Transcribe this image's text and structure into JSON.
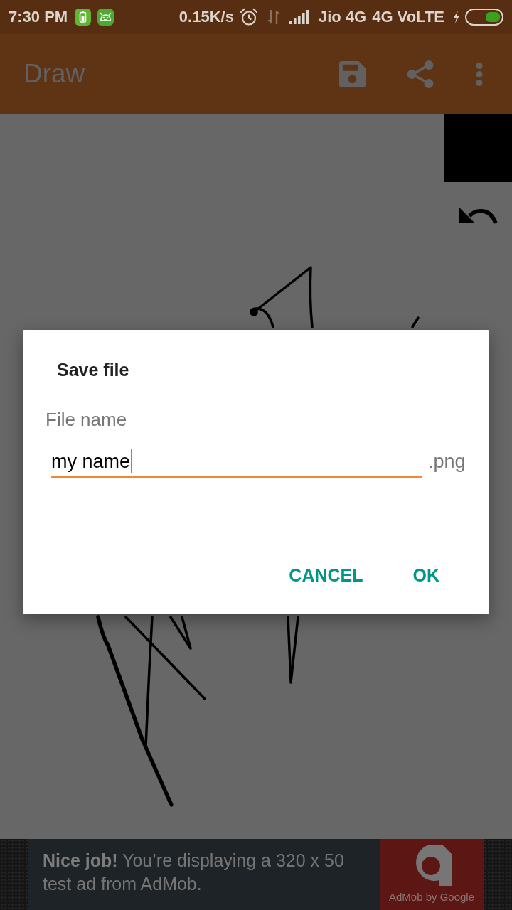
{
  "status_bar": {
    "time": "7:30 PM",
    "network_speed": "0.15K/s",
    "carrier": "Jio 4G",
    "network_type": "4G VoLTE"
  },
  "app_bar": {
    "title": "Draw"
  },
  "canvas": {
    "color_swatch": {
      "color": "#000000"
    }
  },
  "dialog": {
    "title": "Save file",
    "label": "File name",
    "value": "my name",
    "extension": ".png",
    "buttons": [
      "CANCEL",
      "OK"
    ]
  },
  "ad_banner": {
    "message": "**Nice job!** You’re displaying a 320 x 50 test ad from AdMob.",
    "badge": "AdMob by Google"
  }
}
